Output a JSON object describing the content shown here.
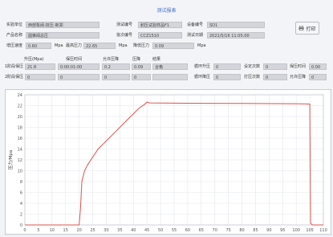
{
  "title": "测试报表",
  "info": {
    "unit_label": "实验单位",
    "unit_value": "西部泵阀-技压-新郑",
    "testno_label": "测试编号",
    "testno_value": "耐压试验样品F1",
    "device_label": "设备编号",
    "device_value": "SD1",
    "product_label": "产品名称",
    "product_value": "圆锥阀总压",
    "batch_label": "批次编号",
    "batch_value": "CCZ1510",
    "testtime_label": "测试日期",
    "testtime_value": "2021/5/16 11:05:00"
  },
  "pressure": {
    "target_label": "增压速度",
    "target_value": "0.60",
    "target_unit": "Mpa",
    "max_label": "最高压力",
    "max_value": "22.65",
    "max_unit": "Mpa",
    "drop_label": "降低压力",
    "drop_value": "0.09",
    "drop_unit": "Mpa"
  },
  "print_button": "打印",
  "table": {
    "headers": [
      "升压(Mpa)",
      "保压时间",
      "允许压降",
      "压降",
      "结果"
    ],
    "row1": {
      "label": "1阶段保压",
      "values": [
        "21.8",
        "0:00:01:00",
        "0.2",
        "0.09",
        "合格"
      ]
    },
    "row2": {
      "label": "2阶段保压",
      "values": [
        "0",
        "0",
        "0",
        "0",
        ""
      ]
    }
  },
  "right_table": {
    "r1": [
      [
        "循环升压",
        "0"
      ],
      [
        "设定次数",
        "0"
      ],
      [
        "保压时间",
        "0.00"
      ]
    ],
    "r2": [
      [
        "循环降压",
        "0"
      ],
      [
        "打压次数",
        "0"
      ],
      [
        "允许压降",
        "0"
      ]
    ]
  },
  "chart_data": {
    "type": "line",
    "ylabel": "压力/Mpa",
    "xlabel": "",
    "x_ticks": [
      0,
      5,
      10,
      15,
      20,
      25,
      30,
      35,
      40,
      45,
      50,
      55,
      60,
      65,
      70,
      75,
      80,
      85,
      90,
      95,
      100,
      105,
      110
    ],
    "y_ticks": [
      0,
      2,
      4,
      6,
      8,
      10,
      12,
      14,
      16,
      18,
      20,
      22,
      24
    ],
    "xlim": [
      0,
      110
    ],
    "ylim": [
      0,
      24
    ],
    "grid": true,
    "series": [
      {
        "color": "#d9534f",
        "x": [
          0,
          20,
          20.5,
          21,
          22,
          23,
          25,
          27,
          30,
          33,
          36,
          39,
          42,
          44,
          45,
          46,
          60,
          80,
          100,
          105,
          105.3,
          106,
          110
        ],
        "y": [
          0,
          0,
          3,
          8,
          10,
          11,
          12.5,
          14,
          15.5,
          17,
          18.5,
          20,
          21.5,
          22.2,
          22.65,
          22.5,
          22.45,
          22.4,
          22.35,
          22.3,
          0.3,
          0,
          0
        ]
      }
    ]
  },
  "colors": {
    "accent": "#3f6fc8",
    "line": "#d9534f",
    "grid": "#e3e6ec"
  }
}
